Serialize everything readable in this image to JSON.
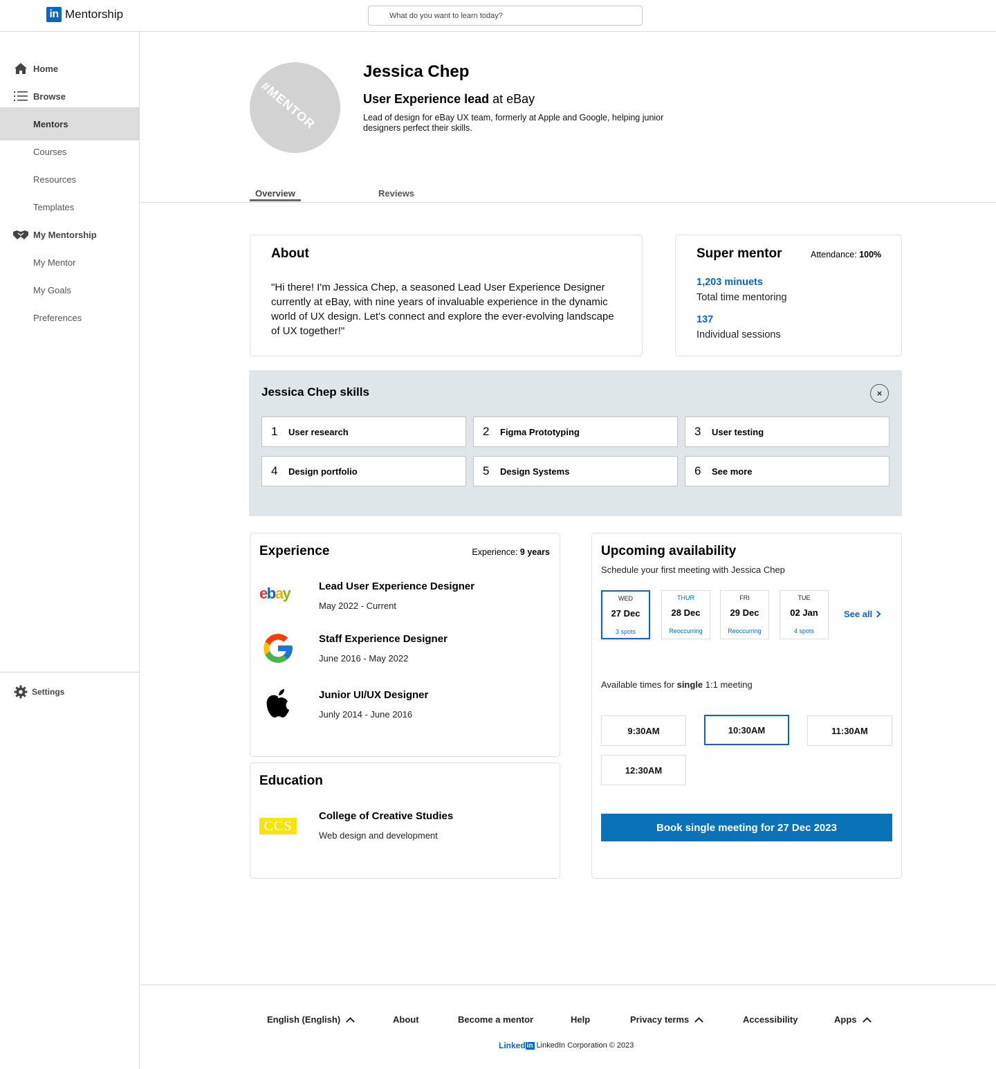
{
  "app": {
    "logo_mark": "in",
    "name": "Mentorship"
  },
  "search": {
    "placeholder": "What do you want to learn today?"
  },
  "sidebar": {
    "items": [
      {
        "label": "Home",
        "icon": "home-icon"
      },
      {
        "label": "Browse",
        "icon": "list-icon"
      },
      {
        "label": "Mentors"
      },
      {
        "label": "Courses"
      },
      {
        "label": "Resources"
      },
      {
        "label": "Templates"
      },
      {
        "label": "My Mentorship",
        "icon": "handshake-icon"
      },
      {
        "label": "My Mentor"
      },
      {
        "label": "My Goals"
      },
      {
        "label": "Preferences"
      }
    ],
    "settings": "Settings"
  },
  "profile": {
    "avatar_text": "#MENTOR",
    "name": "Jessica Chep",
    "role": "User Experience lead",
    "company_prefix": " at eBay",
    "description": "Lead of design for eBay UX team, formerly  at Apple and Google, helping junior designers perfect their skills."
  },
  "tabs": [
    "Overview",
    "Reviews"
  ],
  "about": {
    "title": "About",
    "text": "\"Hi there! I'm Jessica Chep, a seasoned Lead User Experience Designer currently at eBay, with nine years of invaluable experience in the dynamic world of UX design. Let's connect and explore the ever-evolving landscape of UX together!\""
  },
  "super_mentor": {
    "title": "Super mentor",
    "attendance_label": "Attendance: ",
    "attendance_value": "100%",
    "minutes_value": "1,203 minuets",
    "minutes_label": "Total time mentoring",
    "sessions_value": "137",
    "sessions_label": "Individual sessions"
  },
  "skills": {
    "title": "Jessica Chep skills",
    "close": "×",
    "items": [
      {
        "num": "1",
        "label": "User research"
      },
      {
        "num": "2",
        "label": "Figma Prototyping"
      },
      {
        "num": "3",
        "label": "User testing"
      },
      {
        "num": "4",
        "label": "Design portfolio"
      },
      {
        "num": "5",
        "label": "Design Systems"
      },
      {
        "num": "6",
        "label": "See more"
      }
    ]
  },
  "experience": {
    "title": "Experience",
    "years_label": "Experience: ",
    "years_value": "9 years",
    "items": [
      {
        "title": "Lead User Experience Designer",
        "dates": "May 2022 - Current",
        "logo": "ebay-logo"
      },
      {
        "title": "Staff Experience Designer",
        "dates": "June 2016 - May 2022",
        "logo": "google-logo"
      },
      {
        "title": "Junior UI/UX Designer",
        "dates": "Junly 2014 - June 2016",
        "logo": "apple-logo"
      }
    ],
    "ebay_logo_text": "ebay"
  },
  "education": {
    "title": "Education",
    "school": "College of Creative Studies",
    "program": "Web design and development",
    "logo_text": "CCS"
  },
  "availability": {
    "title": "Upcoming availability",
    "subtitle": "Schedule your first meeting with Jessica Chep",
    "days": [
      {
        "dow": "WED",
        "date": "27 Dec",
        "spots": "3 spots"
      },
      {
        "dow": "THUR",
        "date": "28 Dec",
        "spots": "Reoccurring"
      },
      {
        "dow": "FRI",
        "date": "29 Dec",
        "spots": "Reoccurring"
      },
      {
        "dow": "TUE",
        "date": "02 Jan",
        "spots": "4 spots"
      }
    ],
    "see_all": "See all",
    "times_prefix": "Available times for ",
    "times_bold": "single",
    "times_suffix": " 1:1 meeting",
    "slots": [
      "9:30AM",
      "10:30AM",
      "11:30AM",
      "12:30AM"
    ],
    "book_label": "Book single meeting for 27 Dec 2023"
  },
  "footer": {
    "links": [
      "English (English)",
      "About",
      "Become a mentor",
      "Help",
      "Privacy terms",
      "Accessibility",
      "Apps"
    ],
    "brand_text": "Linked",
    "brand_box": "in",
    "copyright": "LinkedIn Corporation © 2023"
  },
  "colors": {
    "brand": "#0a66c2",
    "skills_bg": "#dfe6ea",
    "active_nav": "#dcdcdc"
  }
}
